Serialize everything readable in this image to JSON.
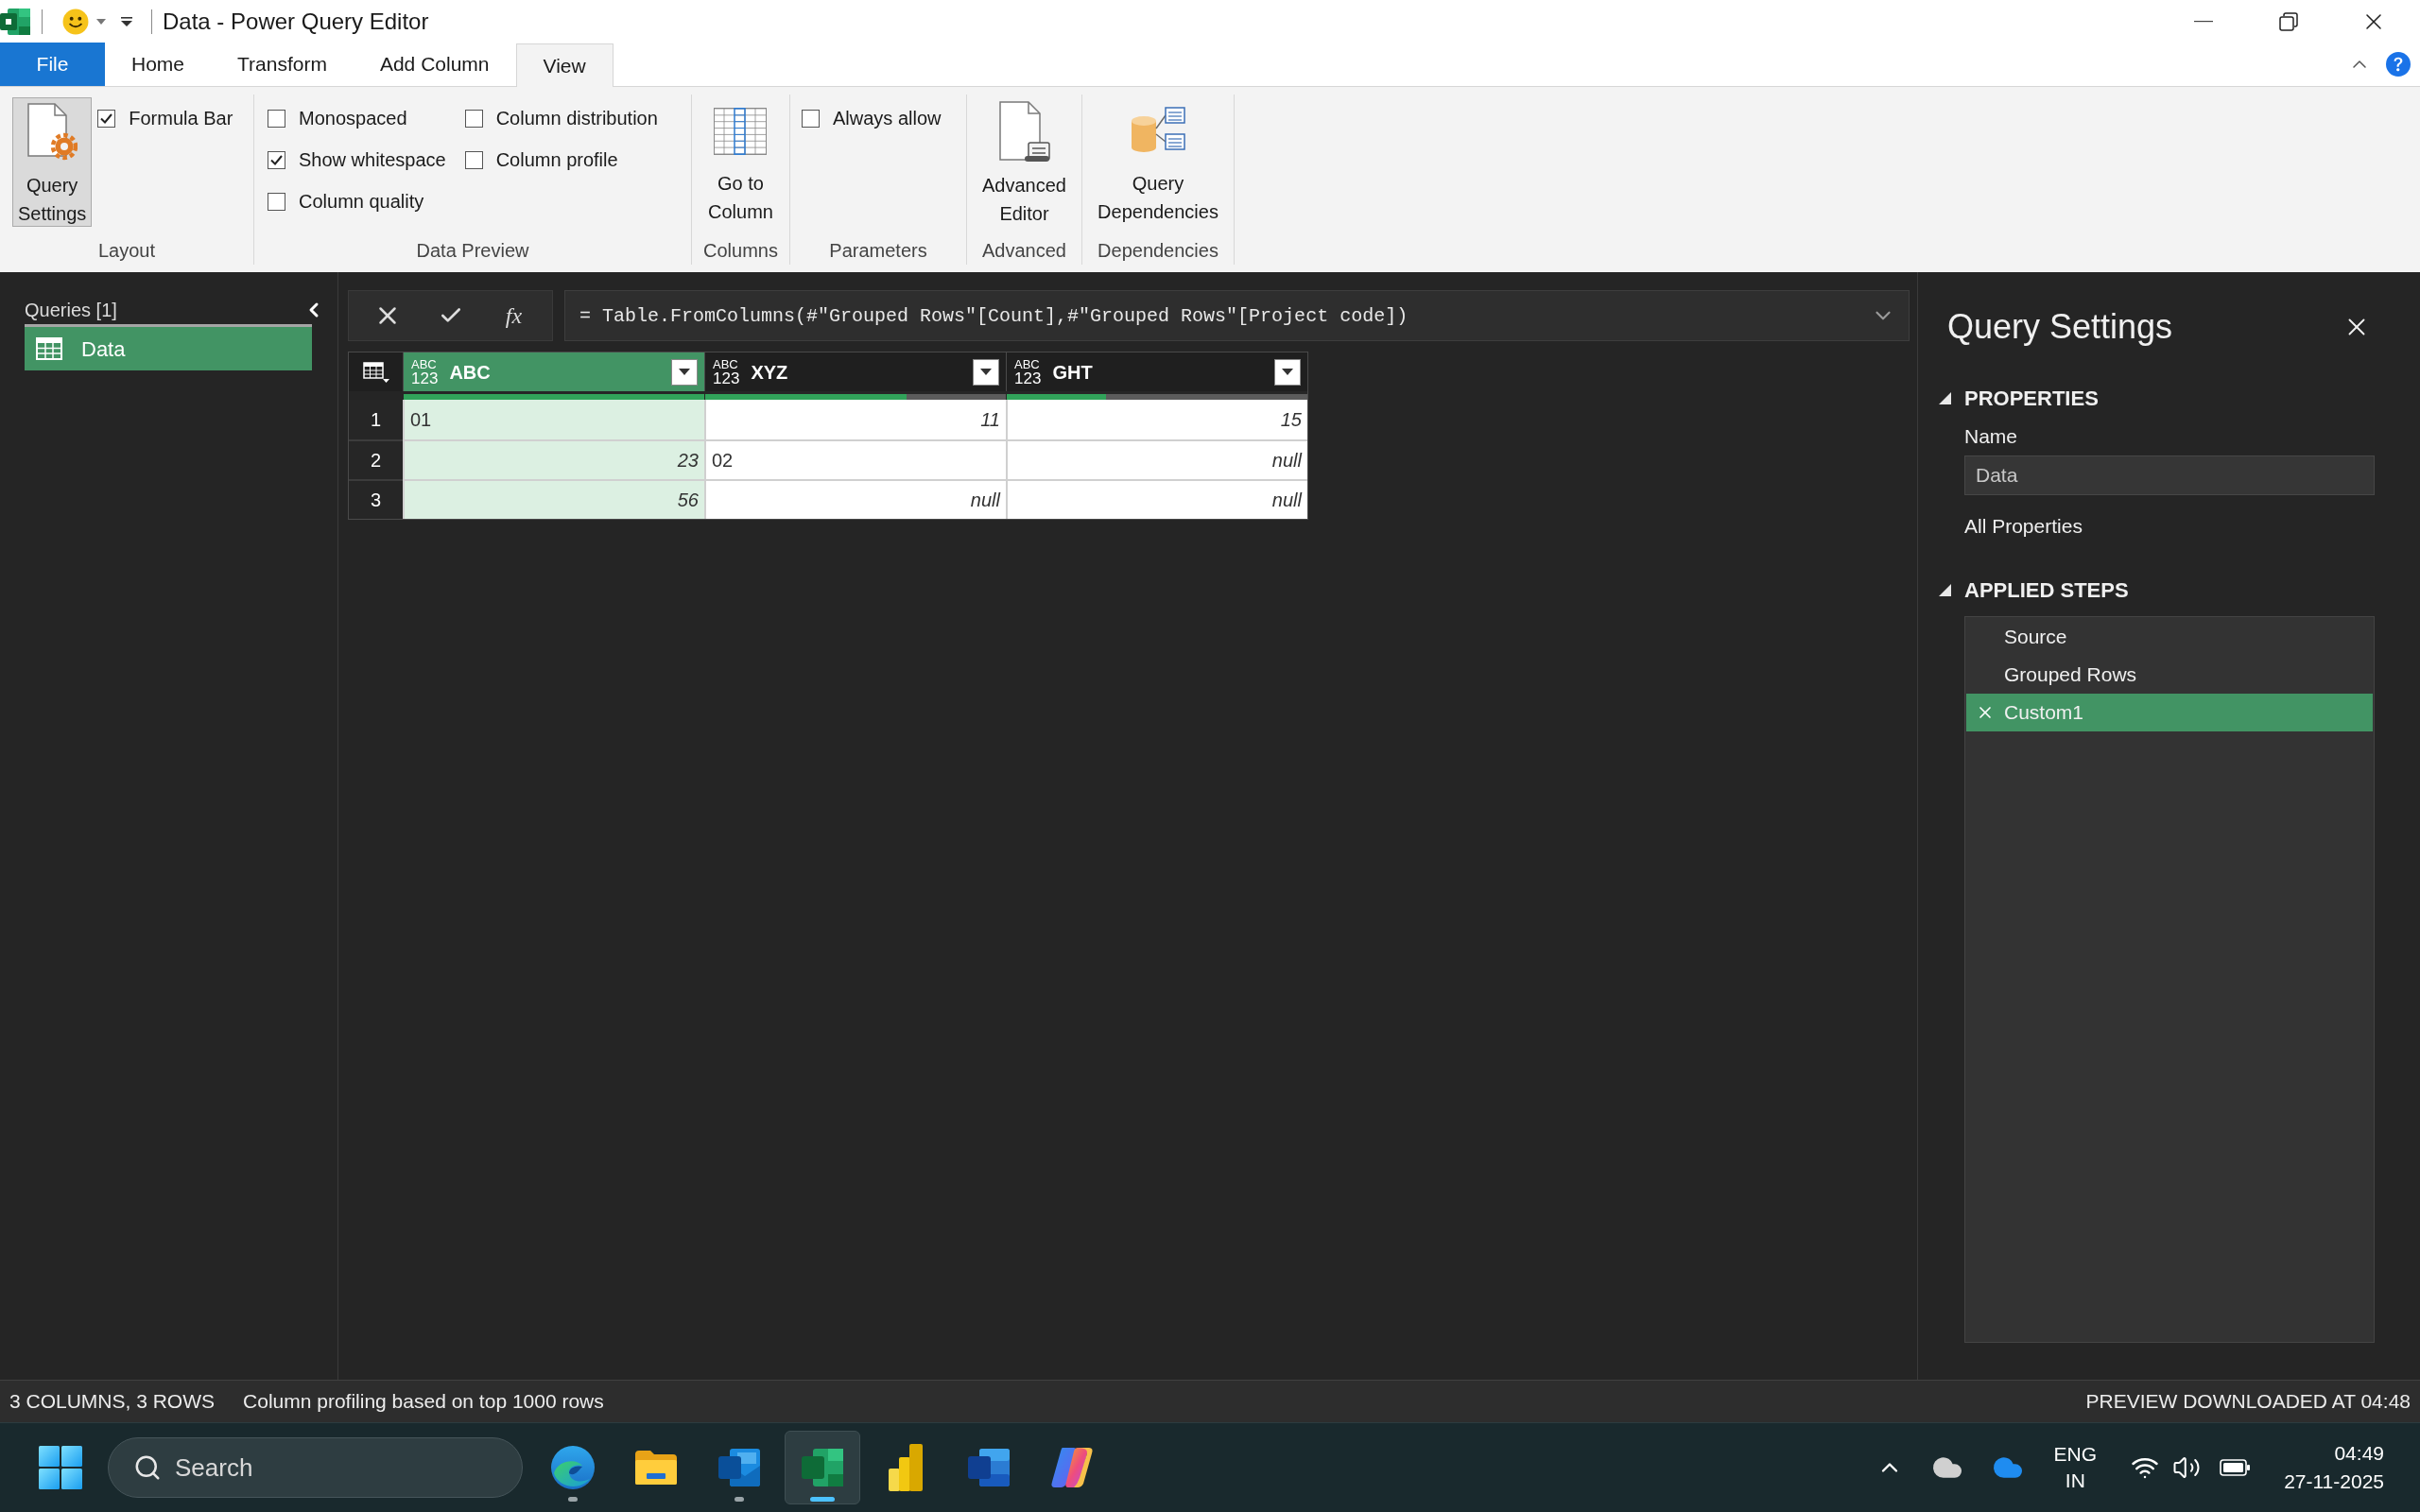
{
  "window": {
    "title": "Data - Power Query Editor"
  },
  "ribbon_tabs": [
    {
      "label": "File",
      "kind": "backstage",
      "selected": false
    },
    {
      "label": "Home",
      "kind": "tab",
      "selected": false
    },
    {
      "label": "Transform",
      "kind": "tab",
      "selected": false
    },
    {
      "label": "Add Column",
      "kind": "tab",
      "selected": false
    },
    {
      "label": "View",
      "kind": "tab",
      "selected": true
    }
  ],
  "ribbon": {
    "groups": [
      {
        "label": "Layout",
        "items": [
          {
            "kind": "large_button",
            "lines": [
              "Query",
              "Settings"
            ],
            "on": true
          },
          {
            "kind": "checkbox",
            "label": "Formula Bar",
            "checked": true
          }
        ]
      },
      {
        "label": "Data Preview",
        "items": [
          {
            "kind": "checkbox",
            "label": "Monospaced",
            "checked": false
          },
          {
            "kind": "checkbox",
            "label": "Show whitespace",
            "checked": true
          },
          {
            "kind": "checkbox",
            "label": "Column quality",
            "checked": false
          },
          {
            "kind": "checkbox",
            "label": "Column distribution",
            "checked": false
          },
          {
            "kind": "checkbox",
            "label": "Column profile",
            "checked": false
          }
        ]
      },
      {
        "label": "Columns",
        "items": [
          {
            "kind": "large_button",
            "lines": [
              "Go to",
              "Column"
            ],
            "on": false
          }
        ]
      },
      {
        "label": "Parameters",
        "items": [
          {
            "kind": "checkbox",
            "label": "Always allow",
            "checked": false
          }
        ]
      },
      {
        "label": "Advanced",
        "items": [
          {
            "kind": "large_button",
            "lines": [
              "Advanced",
              "Editor"
            ],
            "on": false
          }
        ]
      },
      {
        "label": "Dependencies",
        "items": [
          {
            "kind": "large_button",
            "lines": [
              "Query",
              "Dependencies"
            ],
            "on": false
          }
        ]
      }
    ]
  },
  "queries_pane": {
    "title": "Queries [1]",
    "items": [
      {
        "label": "Data",
        "selected": true
      }
    ]
  },
  "formula_bar": {
    "function_label": "fx",
    "formula": "= Table.FromColumns(#\"Grouped Rows\"[Count],#\"Grouped Rows\"[Project code])"
  },
  "table": {
    "columns": [
      {
        "type_label": [
          "ABC",
          "123"
        ],
        "name": "ABC",
        "selected": true,
        "level": 1
      },
      {
        "type_label": [
          "ABC",
          "123"
        ],
        "name": "XYZ",
        "selected": false,
        "level": 0.67
      },
      {
        "type_label": [
          "ABC",
          "123"
        ],
        "name": "GHT",
        "selected": false,
        "level": 0.33
      }
    ],
    "rows": [
      {
        "number": "1",
        "cells": [
          {
            "kind": "text",
            "value": "01"
          },
          {
            "kind": "number",
            "value": "11"
          },
          {
            "kind": "number",
            "value": "15"
          }
        ]
      },
      {
        "number": "2",
        "cells": [
          {
            "kind": "number",
            "value": "23"
          },
          {
            "kind": "text",
            "value": "02"
          },
          {
            "kind": "null",
            "value": "null"
          }
        ]
      },
      {
        "number": "3",
        "cells": [
          {
            "kind": "number",
            "value": "56"
          },
          {
            "kind": "null",
            "value": "null"
          },
          {
            "kind": "null",
            "value": "null"
          }
        ]
      }
    ]
  },
  "query_settings": {
    "title": "Query Settings",
    "properties": {
      "heading": "PROPERTIES",
      "expanded": true,
      "name_label": "Name",
      "name_value": "Data",
      "all_properties": "All Properties"
    },
    "applied_steps": {
      "heading": "APPLIED STEPS",
      "expanded": true,
      "steps": [
        {
          "label": "Source",
          "selected": false
        },
        {
          "label": "Grouped Rows",
          "selected": false
        },
        {
          "label": "Custom1",
          "selected": true
        }
      ]
    }
  },
  "status_bar": {
    "left": [
      "3 COLUMNS, 3 ROWS",
      "Column profiling based on top 1000 rows"
    ],
    "right": "PREVIEW DOWNLOADED AT 04:48"
  },
  "taskbar": {
    "search": {
      "placeholder": "Search"
    },
    "apps": [
      {
        "kind": "browser",
        "running": true,
        "active": false
      },
      {
        "kind": "folder",
        "running": false,
        "active": false
      },
      {
        "kind": "mail",
        "running": true,
        "active": false
      },
      {
        "kind": "spreadsheet",
        "running": true,
        "active": true
      },
      {
        "kind": "chart",
        "running": false,
        "active": false
      },
      {
        "kind": "document",
        "running": false,
        "active": false
      },
      {
        "kind": "assistant",
        "running": false,
        "active": false
      }
    ],
    "tray": {
      "language": [
        "ENG",
        "IN"
      ],
      "time": "04:49",
      "date": "27-11-2025"
    }
  }
}
